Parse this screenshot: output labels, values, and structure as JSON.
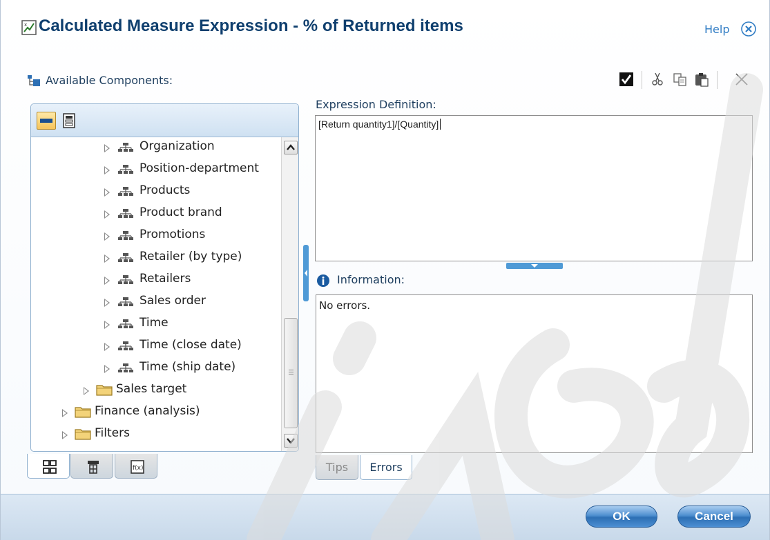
{
  "dialog": {
    "title": "Calculated Measure Expression - % of Returned items",
    "help_label": "Help",
    "close_icon": "close-circle-icon"
  },
  "components": {
    "label": "Available Components:",
    "tree_items": [
      {
        "label": "Organization",
        "type": "dimension",
        "level": 2
      },
      {
        "label": "Position-department",
        "type": "dimension",
        "level": 2
      },
      {
        "label": "Products",
        "type": "dimension",
        "level": 2
      },
      {
        "label": "Product brand",
        "type": "dimension",
        "level": 2
      },
      {
        "label": "Promotions",
        "type": "dimension",
        "level": 2
      },
      {
        "label": "Retailer (by type)",
        "type": "dimension",
        "level": 2
      },
      {
        "label": "Retailers",
        "type": "dimension",
        "level": 2
      },
      {
        "label": "Sales order",
        "type": "dimension",
        "level": 2
      },
      {
        "label": "Time",
        "type": "dimension",
        "level": 2
      },
      {
        "label": "Time (close date)",
        "type": "dimension",
        "level": 2
      },
      {
        "label": "Time (ship date)",
        "type": "dimension",
        "level": 2
      },
      {
        "label": "Sales target",
        "type": "folder",
        "level": 1
      },
      {
        "label": "Finance (analysis)",
        "type": "folder",
        "level": 0
      },
      {
        "label": "Filters",
        "type": "folder",
        "level": 0
      }
    ]
  },
  "expression": {
    "label": "Expression Definition:",
    "value": "[Return quantity1]/[Quantity]"
  },
  "information": {
    "label": "Information:",
    "text": "No errors."
  },
  "tabs": {
    "tips": "Tips",
    "errors": "Errors"
  },
  "buttons": {
    "ok": "OK",
    "cancel": "Cancel"
  },
  "colors": {
    "title": "#0f3f6e",
    "accent": "#4f9ad6",
    "button": "#2d6fb4"
  }
}
